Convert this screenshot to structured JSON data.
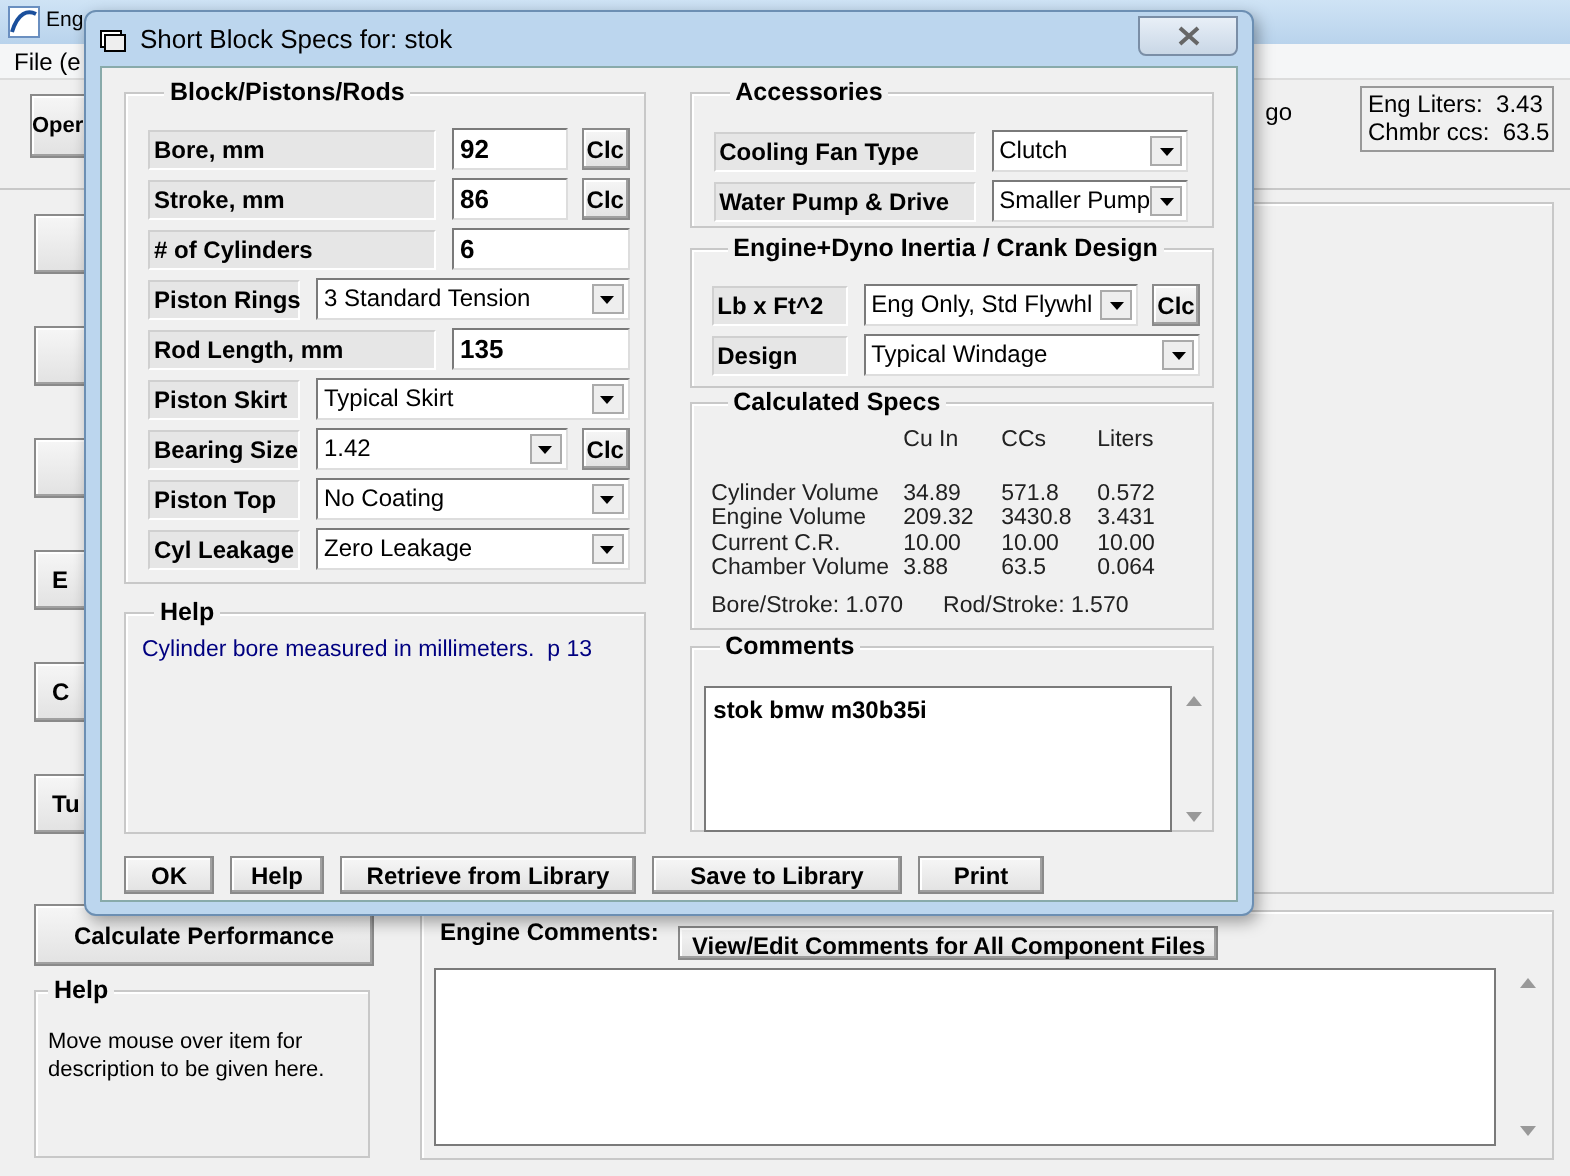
{
  "app": {
    "title": "Eng",
    "menu": [
      "File (e"
    ],
    "open_button": "Oper",
    "status_text": "go",
    "eng_liters": {
      "label": "Eng Liters:",
      "value": "3.43"
    },
    "chmbr_ccs": {
      "label": "Chmbr ccs:",
      "value": "63.5"
    },
    "side_buttons": [
      {
        "kind": "blank"
      },
      {
        "kind": "blank"
      },
      {
        "kind": "blank"
      },
      {
        "kind": "labeled",
        "label": "E"
      },
      {
        "kind": "labeled",
        "label": "C"
      },
      {
        "kind": "labeled",
        "label": "Tu"
      }
    ],
    "calculate_button": "Calculate Performance",
    "help": {
      "title": "Help",
      "text": "Move mouse over item for description to be given here."
    },
    "engine_comments": {
      "label": "Engine Comments:",
      "button": "View/Edit Comments for All Component Files"
    }
  },
  "dialog": {
    "title": "Short Block Specs for: stok",
    "block_group": {
      "title": "Block/Pistons/Rods",
      "rows": [
        {
          "kind": "input",
          "label": "Bore, mm",
          "value": "92",
          "button": "Clc"
        },
        {
          "kind": "input",
          "label": "Stroke, mm",
          "value": "86",
          "button": "Clc"
        },
        {
          "kind": "input",
          "label": "# of Cylinders",
          "value": "6"
        },
        {
          "kind": "select",
          "label": "Piston Rings",
          "value": "3 Standard Tension"
        },
        {
          "kind": "input",
          "label": "Rod Length, mm",
          "value": "135"
        },
        {
          "kind": "select",
          "label": "Piston Skirt",
          "value": "Typical Skirt"
        },
        {
          "kind": "select",
          "label": "Bearing Size",
          "value": "1.42",
          "button": "Clc"
        },
        {
          "kind": "select",
          "label": "Piston Top",
          "value": "No Coating"
        },
        {
          "kind": "select",
          "label": "Cyl Leakage",
          "value": "Zero Leakage"
        }
      ]
    },
    "help": {
      "title": "Help",
      "text": "Cylinder bore measured in millimeters.  p 13"
    },
    "accessories": {
      "title": "Accessories",
      "rows": [
        {
          "kind": "select",
          "label": "Cooling Fan Type",
          "value": "Clutch"
        },
        {
          "kind": "select",
          "label": "Water Pump & Drive",
          "value": "Smaller Pump"
        }
      ]
    },
    "inertia": {
      "title": "Engine+Dyno Inertia / Crank Design",
      "rows": [
        {
          "kind": "select",
          "label": "Lb x Ft^2",
          "value": "Eng Only, Std Flywhl",
          "button": "Clc"
        },
        {
          "kind": "select",
          "label": "Design",
          "value": "Typical Windage"
        }
      ]
    },
    "calculated": {
      "title": "Calculated Specs",
      "columns": [
        "Cu In",
        "CCs",
        "Liters"
      ],
      "rows": [
        {
          "label": "Cylinder Volume",
          "values": [
            "34.89",
            "571.8",
            "0.572"
          ]
        },
        {
          "label": "Engine Volume",
          "values": [
            "209.32",
            "3430.8",
            "3.431"
          ]
        },
        {
          "label": "Current C.R.",
          "values": [
            "10.00",
            "10.00",
            "10.00"
          ]
        },
        {
          "label": "Chamber Volume",
          "values": [
            "3.88",
            "63.5",
            "0.064"
          ]
        }
      ],
      "ratios": [
        "Bore/Stroke: 1.070",
        "Rod/Stroke: 1.570"
      ]
    },
    "comments": {
      "title": "Comments",
      "text": "stok bmw m30b35i"
    },
    "buttons": [
      "OK",
      "Help",
      "Retrieve from Library",
      "Save to Library",
      "Print"
    ]
  }
}
